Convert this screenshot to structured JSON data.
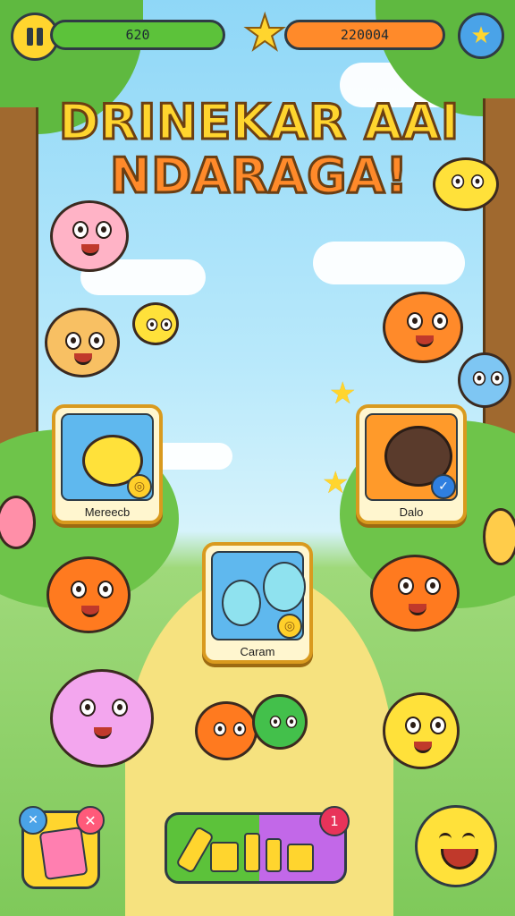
{
  "hud": {
    "score_value": "620",
    "coins_value": "220004",
    "pause_icon": "pause-icon",
    "star_icon": "star-icon",
    "settings_icon": "star-badge-icon"
  },
  "title": {
    "line1": "DRINEKAR AAI",
    "line2": "NDARAGA!"
  },
  "cards": [
    {
      "label": "Mereecb",
      "badge": "coin-badge-icon"
    },
    {
      "label": "Dalo",
      "badge": "check-badge-icon"
    },
    {
      "label": "Caram",
      "badge": "coin-badge-icon"
    }
  ],
  "bottom_bar": {
    "left_button_icon": "card-deck-icon",
    "center_button_icon": "tools-icon",
    "center_badge": "1",
    "right_button_icon": "smiley-icon"
  },
  "colors": {
    "score_bar": "#5cc23a",
    "coins_bar": "#ff8a2a",
    "title_fill_1": "#ffd52e",
    "title_fill_2": "#ff8a2a",
    "outline": "#2f3b44"
  }
}
